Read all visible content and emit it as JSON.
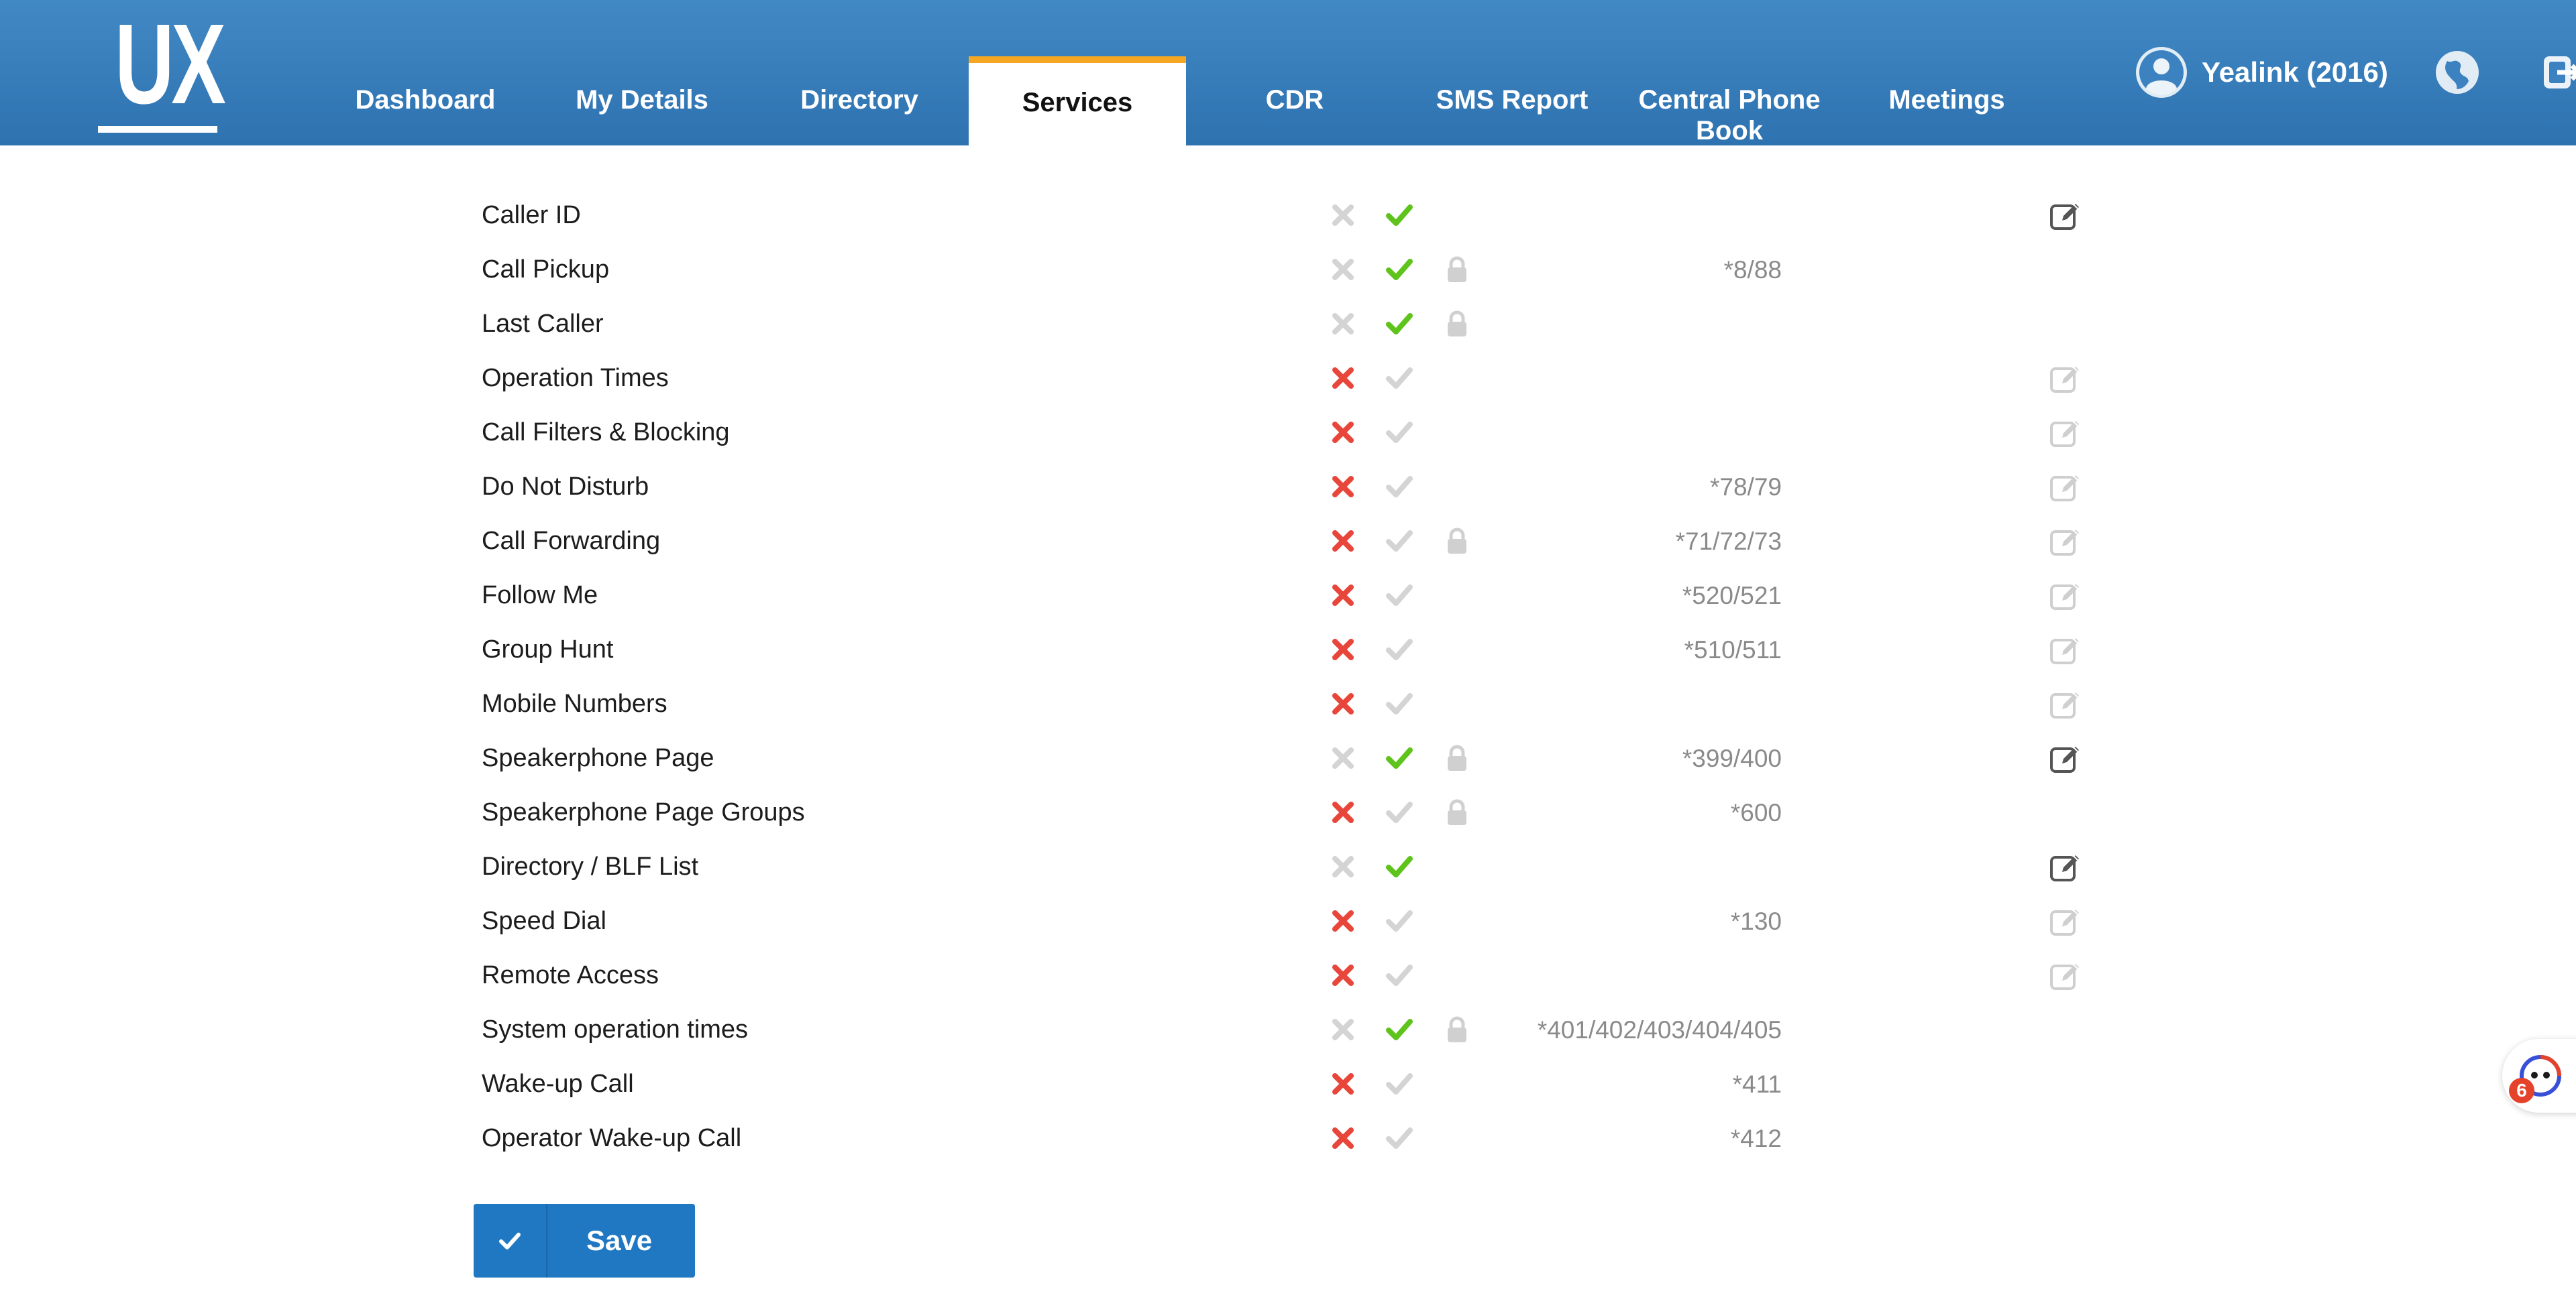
{
  "header": {
    "logo_text": "UX",
    "nav": [
      {
        "label": "Dashboard",
        "active": false
      },
      {
        "label": "My Details",
        "active": false
      },
      {
        "label": "Directory",
        "active": false
      },
      {
        "label": "Services",
        "active": true
      },
      {
        "label": "CDR",
        "active": false
      },
      {
        "label": "SMS Report",
        "active": false
      },
      {
        "label": "Central Phone Book",
        "active": false
      },
      {
        "label": "Meetings",
        "active": false
      }
    ],
    "user_name": "Yealink (2016)",
    "icons": {
      "avatar": "user-avatar-icon",
      "globe": "globe-icon",
      "logout": "logout-icon"
    }
  },
  "colors": {
    "header": "#3a82c0",
    "active_tab_accent": "#f5a623",
    "enabled_check": "#5ec31b",
    "disabled_x": "#e8463a",
    "inactive_icon": "#d4d4d4",
    "save_button": "#1f78c1"
  },
  "services": [
    {
      "name": "Caller ID",
      "code": "",
      "enabled": true,
      "locked": false,
      "edit": "active"
    },
    {
      "name": "Call Pickup",
      "code": "*8/88",
      "enabled": true,
      "locked": true,
      "edit": "none"
    },
    {
      "name": "Last Caller",
      "code": "",
      "enabled": true,
      "locked": true,
      "edit": "none"
    },
    {
      "name": "Operation Times",
      "code": "",
      "enabled": false,
      "locked": false,
      "edit": "inactive"
    },
    {
      "name": "Call Filters & Blocking",
      "code": "",
      "enabled": false,
      "locked": false,
      "edit": "inactive"
    },
    {
      "name": "Do Not Disturb",
      "code": "*78/79",
      "enabled": false,
      "locked": false,
      "edit": "inactive"
    },
    {
      "name": "Call Forwarding",
      "code": "*71/72/73",
      "enabled": false,
      "locked": true,
      "edit": "inactive"
    },
    {
      "name": "Follow Me",
      "code": "*520/521",
      "enabled": false,
      "locked": false,
      "edit": "inactive"
    },
    {
      "name": "Group Hunt",
      "code": "*510/511",
      "enabled": false,
      "locked": false,
      "edit": "inactive"
    },
    {
      "name": "Mobile Numbers",
      "code": "",
      "enabled": false,
      "locked": false,
      "edit": "inactive"
    },
    {
      "name": "Speakerphone Page",
      "code": "*399/400",
      "enabled": true,
      "locked": true,
      "edit": "active"
    },
    {
      "name": "Speakerphone Page Groups",
      "code": "*600",
      "enabled": false,
      "locked": true,
      "edit": "none"
    },
    {
      "name": "Directory / BLF List",
      "code": "",
      "enabled": true,
      "locked": false,
      "edit": "active"
    },
    {
      "name": "Speed Dial",
      "code": "*130",
      "enabled": false,
      "locked": false,
      "edit": "inactive"
    },
    {
      "name": "Remote Access",
      "code": "",
      "enabled": false,
      "locked": false,
      "edit": "inactive"
    },
    {
      "name": "System operation times",
      "code": "*401/402/403/404/405",
      "enabled": true,
      "locked": true,
      "edit": "none"
    },
    {
      "name": "Wake-up Call",
      "code": "*411",
      "enabled": false,
      "locked": false,
      "edit": "none"
    },
    {
      "name": "Operator Wake-up Call",
      "code": "*412",
      "enabled": false,
      "locked": false,
      "edit": "none"
    }
  ],
  "save": {
    "label": "Save",
    "icon": "check-icon"
  },
  "widget": {
    "badge": "6",
    "icon": "chat-bot-icon"
  }
}
